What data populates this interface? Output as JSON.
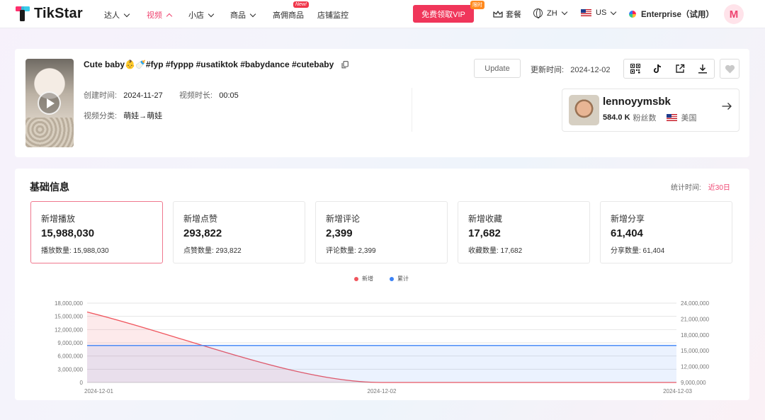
{
  "nav": {
    "brand": "TikStar",
    "items": [
      {
        "label": "达人"
      },
      {
        "label": "视频"
      },
      {
        "label": "小店"
      },
      {
        "label": "商品"
      },
      {
        "label": "高佣商品"
      },
      {
        "label": "店铺监控"
      }
    ],
    "new_badge": "New!",
    "vip_button": "免费领取VIP",
    "limit_badge": "限时",
    "package": "套餐",
    "language": "ZH",
    "region": "US",
    "enterprise": "Enterprise（试用）",
    "avatar_letter": "M"
  },
  "video": {
    "title": "Cute baby👶🍼#fyp #fyppp #usatiktok #babydance #cutebaby",
    "created_label": "创建时间:",
    "created": "2024-11-27",
    "duration_label": "视频时长:",
    "duration": "00:05",
    "category_label": "视频分类:",
    "category": "萌娃→萌娃",
    "update_button": "Update",
    "updated_label": "更新时间:",
    "updated": "2024-12-02"
  },
  "creator": {
    "name": "lennoyymsbk",
    "followers": "584.0 K",
    "followers_label": "粉丝数",
    "country": "美国"
  },
  "basic_info": {
    "title": "基础信息",
    "stat_time_label": "统计时间:",
    "stat_time_value": "近30日",
    "metrics": [
      {
        "label": "新增播放",
        "value": "15,988,030",
        "sub": "播放数量: 15,988,030"
      },
      {
        "label": "新增点赞",
        "value": "293,822",
        "sub": "点赞数量: 293,822"
      },
      {
        "label": "新增评论",
        "value": "2,399",
        "sub": "评论数量: 2,399"
      },
      {
        "label": "新增收藏",
        "value": "17,682",
        "sub": "收藏数量: 17,682"
      },
      {
        "label": "新增分享",
        "value": "61,404",
        "sub": "分享数量: 61,404"
      }
    ]
  },
  "chart_data": {
    "type": "line",
    "x": [
      "2024-12-01",
      "2024-12-02",
      "2024-12-03"
    ],
    "series": [
      {
        "name": "新增",
        "axis": "left",
        "color": "#f0555d",
        "values": [
          15988030,
          0,
          0
        ]
      },
      {
        "name": "累计",
        "axis": "right",
        "color": "#3b82f6",
        "values": [
          15988030,
          15988030,
          15988030
        ]
      }
    ],
    "y_left": {
      "ticks": [
        "0",
        "3,000,000",
        "6,000,000",
        "9,000,000",
        "12,000,000",
        "15,000,000",
        "18,000,000"
      ],
      "range": [
        0,
        18000000
      ]
    },
    "y_right": {
      "ticks": [
        "9,000,000",
        "12,000,000",
        "15,000,000",
        "18,000,000",
        "21,000,000",
        "24,000,000"
      ],
      "range": [
        9000000,
        24000000
      ]
    },
    "legend_position": "top-center",
    "grid": true
  }
}
